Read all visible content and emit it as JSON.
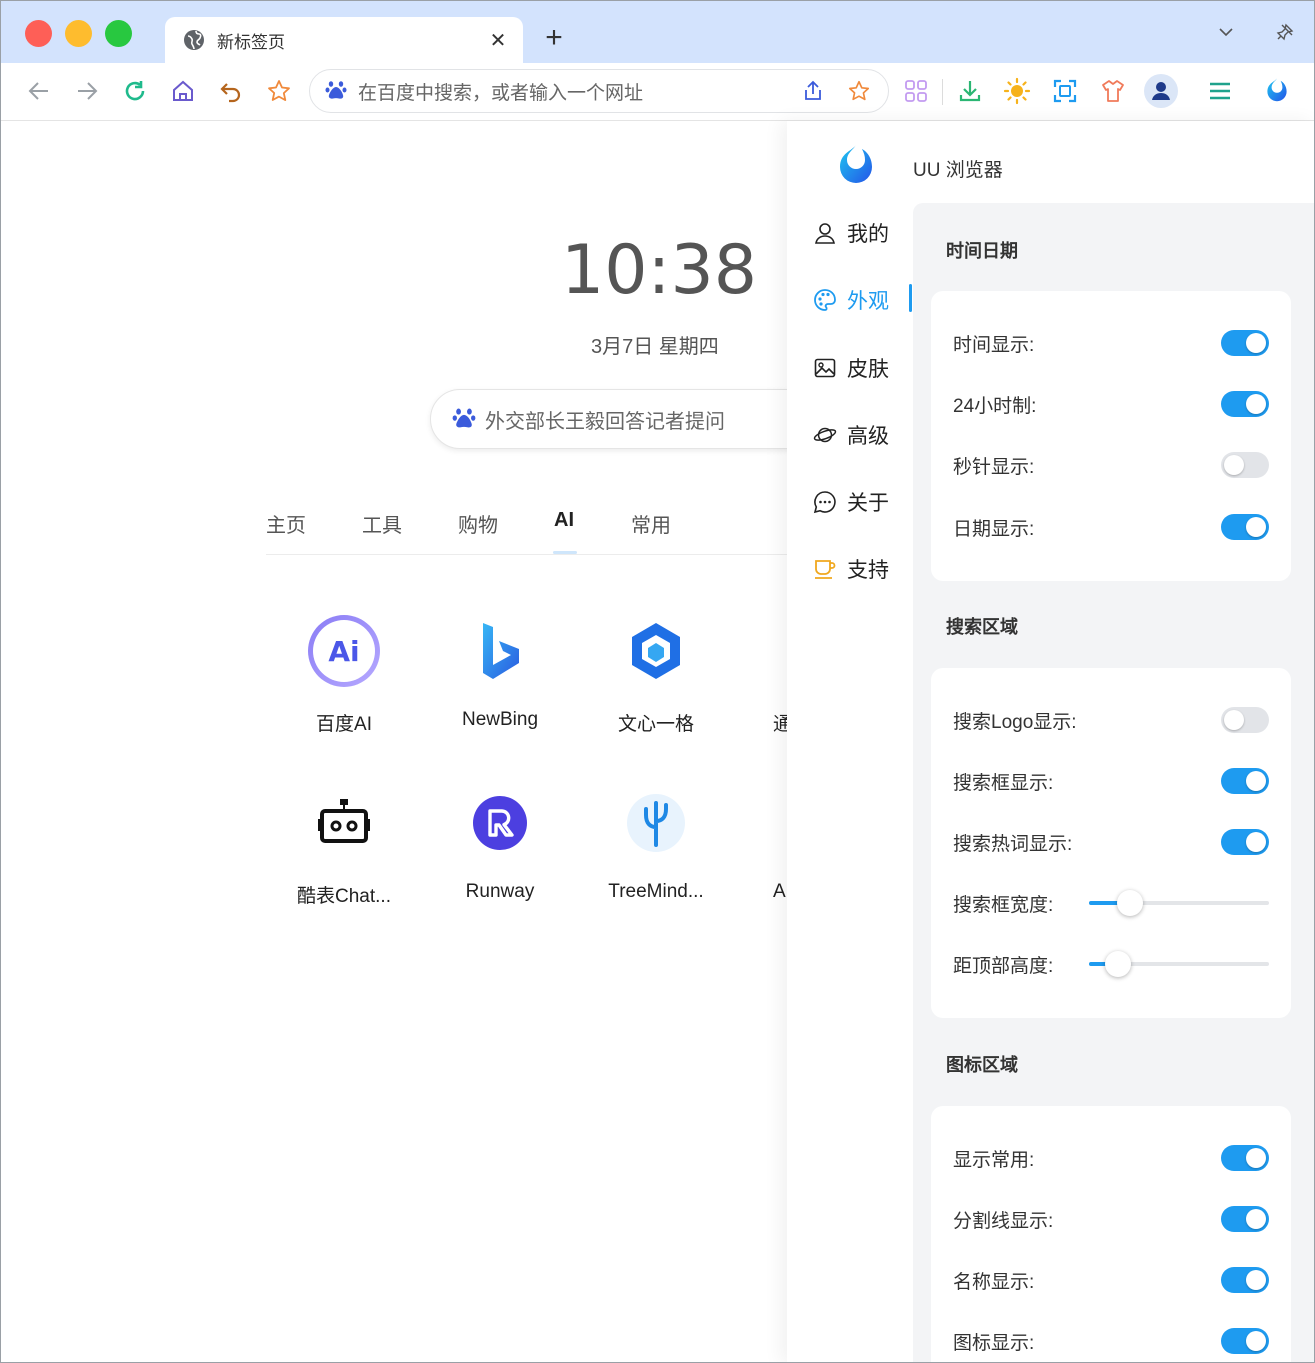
{
  "browser": {
    "tab_title": "新标签页",
    "new_tab_symbol": "+",
    "close_symbol": "✕",
    "address_placeholder": "在百度中搜索，或者输入一个网址"
  },
  "ntp": {
    "time": "10:38",
    "date": "3月7日 星期四",
    "hot_search": "外交部长王毅回答记者提问",
    "categories": [
      "主页",
      "工具",
      "购物",
      "AI",
      "常用"
    ],
    "active_category": "AI",
    "apps": [
      {
        "name": "百度AI",
        "icon": "baidu-ai-icon"
      },
      {
        "name": "NewBing",
        "icon": "newbing-icon"
      },
      {
        "name": "文心一格",
        "icon": "wenxin-yige-icon"
      },
      {
        "name": "通",
        "icon": "partial-app-icon"
      },
      {
        "name": "酷表Chat...",
        "icon": "robot-icon"
      },
      {
        "name": "Runway",
        "icon": "runway-icon"
      },
      {
        "name": "TreeMind...",
        "icon": "treemind-icon"
      },
      {
        "name": "A",
        "icon": "partial-app-icon"
      }
    ]
  },
  "settings": {
    "brand": "UU 浏览器",
    "nav": [
      {
        "label": "我的",
        "icon": "user-icon"
      },
      {
        "label": "外观",
        "icon": "palette-icon"
      },
      {
        "label": "皮肤",
        "icon": "image-icon"
      },
      {
        "label": "高级",
        "icon": "planet-icon"
      },
      {
        "label": "关于",
        "icon": "chat-bubble-icon"
      },
      {
        "label": "支持",
        "icon": "coffee-cup-icon"
      }
    ],
    "active_nav": "外观",
    "sections": {
      "time": {
        "title": "时间日期",
        "rows": [
          {
            "label": "时间显示:",
            "on": true
          },
          {
            "label": "24小时制:",
            "on": true
          },
          {
            "label": "秒针显示:",
            "on": false
          },
          {
            "label": "日期显示:",
            "on": true
          }
        ]
      },
      "search": {
        "title": "搜索区域",
        "rows": [
          {
            "label": "搜索Logo显示:",
            "on": false
          },
          {
            "label": "搜索框显示:",
            "on": true
          },
          {
            "label": "搜索热词显示:",
            "on": true
          }
        ],
        "sliders": [
          {
            "label": "搜索框宽度:",
            "value": 0.23
          },
          {
            "label": "距顶部高度:",
            "value": 0.16
          }
        ]
      },
      "icons": {
        "title": "图标区域",
        "rows": [
          {
            "label": "显示常用:",
            "on": true
          },
          {
            "label": "分割线显示:",
            "on": true
          },
          {
            "label": "名称显示:",
            "on": true
          },
          {
            "label": "图标显示:",
            "on": true
          }
        ]
      }
    }
  },
  "colors": {
    "accent": "#1e9bf0",
    "tabstrip": "#d3e3fd",
    "traffic_red": "#fe5f57",
    "traffic_yellow": "#febc2e",
    "traffic_green": "#28c840"
  }
}
